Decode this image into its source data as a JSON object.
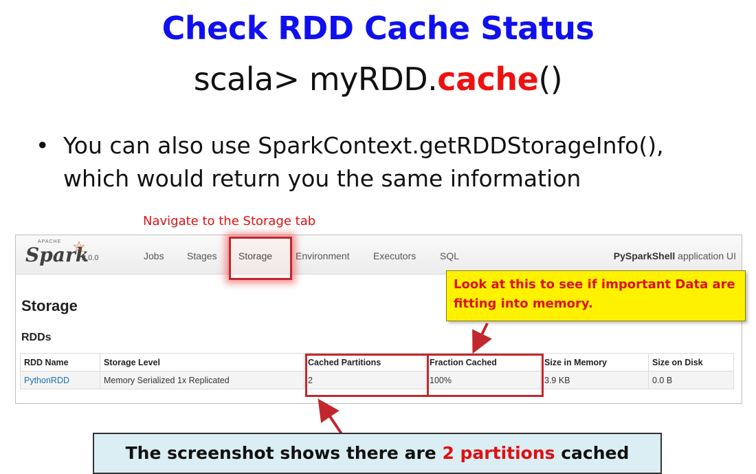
{
  "slide": {
    "title": "Check RDD Cache Status",
    "code_prefix": "scala> myRDD.",
    "code_method": "cache",
    "code_suffix": "()",
    "bullet_symbol": "•",
    "bullet": "You can also use SparkContext.getRDDStorageInfo(), which  would return you the same information",
    "nav_annotation": "Navigate to the Storage tab",
    "memory_callout": "Look at this to see if important Data are fitting into memory.",
    "bottom_callout": {
      "prefix": "The screenshot shows there are ",
      "highlight": "2 partitions",
      "suffix": " cached"
    }
  },
  "spark_ui": {
    "logo_apache": "APACHE",
    "logo_text": "Spark",
    "logo_star": "☆",
    "version": "2.0.0",
    "tabs": [
      "Jobs",
      "Stages",
      "Storage",
      "Environment",
      "Executors",
      "SQL"
    ],
    "active_tab": "Storage",
    "app_name": "PySparkShell",
    "app_suffix": " application UI",
    "page_title": "Storage",
    "section_title": "RDDs",
    "table": {
      "headers": [
        "RDD Name",
        "Storage Level",
        "Cached Partitions",
        "Fraction Cached",
        "Size in Memory",
        "Size on Disk"
      ],
      "rows": [
        [
          "PythonRDD",
          "Memory Serialized 1x Replicated",
          "2",
          "100%",
          "3.9 KB",
          "0.0 B"
        ]
      ]
    }
  },
  "colors": {
    "title_blue": "#1010ee",
    "annotation_red": "#e01010",
    "highlight_box_red": "#c1272d",
    "callout_yellow": "#fef200",
    "callout_blue": "#dbeef4",
    "link_blue": "#1a6fb5"
  }
}
